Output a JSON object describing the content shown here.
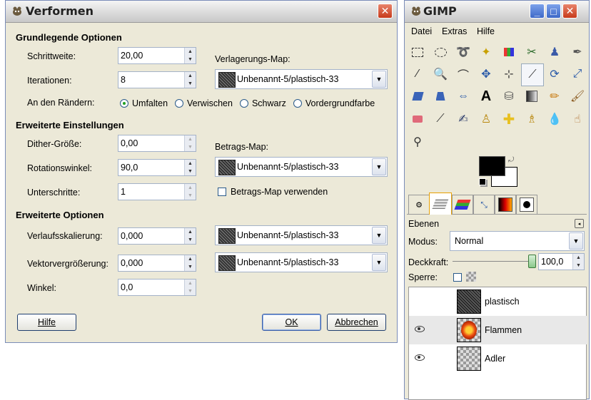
{
  "dialog": {
    "title": "Verformen",
    "sections": {
      "basic": "Grundlegende Optionen",
      "advanced_settings": "Erweiterte Einstellungen",
      "advanced_options": "Erweiterte Optionen"
    },
    "fields": {
      "step_label": "Schrittweite:",
      "step_value": "20,00",
      "iterations_label": "Iterationen:",
      "iterations_value": "8",
      "edges_label": "An den Rändern:",
      "dither_label": "Dither-Größe:",
      "dither_value": "0,00",
      "rotation_label": "Rotationswinkel:",
      "rotation_value": "90,0",
      "substeps_label": "Unterschritte:",
      "substeps_value": "1",
      "gradient_label": "Verlaufsskalierung:",
      "gradient_value": "0,000",
      "vector_label": "Vektorvergrößerung:",
      "vector_value": "0,000",
      "angle_label": "Winkel:",
      "angle_value": "0,0"
    },
    "edge_options": [
      "Umfalten",
      "Verwischen",
      "Schwarz",
      "Vordergrundfarbe"
    ],
    "edge_selected": "Umfalten",
    "maps": {
      "displacement_label": "Verlagerungs-Map:",
      "displacement_value": "Unbenannt-5/plastisch-33",
      "magnitude_label": "Betrags-Map:",
      "magnitude_value": "Unbenannt-5/plastisch-33",
      "use_magnitude_label": "Betrags-Map verwenden",
      "gradient_map_value": "Unbenannt-5/plastisch-33",
      "vector_map_value": "Unbenannt-5/plastisch-33"
    },
    "buttons": {
      "help": "Hilfe",
      "ok": "OK",
      "cancel": "Abbrechen"
    }
  },
  "gimp": {
    "title": "GIMP",
    "menu": [
      "Datei",
      "Extras",
      "Hilfe"
    ],
    "layers_tab_title": "Ebenen",
    "mode_label": "Modus:",
    "mode_value": "Normal",
    "opacity_label": "Deckkraft:",
    "opacity_value": "100,0",
    "lock_label": "Sperre:",
    "layers": [
      {
        "name": "plastisch",
        "visible": false
      },
      {
        "name": "Flammen",
        "visible": true
      },
      {
        "name": "Adler",
        "visible": true
      }
    ]
  },
  "colors": {
    "window_bg": "#ece9d8",
    "close_button": "#c73a1c",
    "foreground_color": "#000000",
    "background_color": "#ffffff"
  }
}
